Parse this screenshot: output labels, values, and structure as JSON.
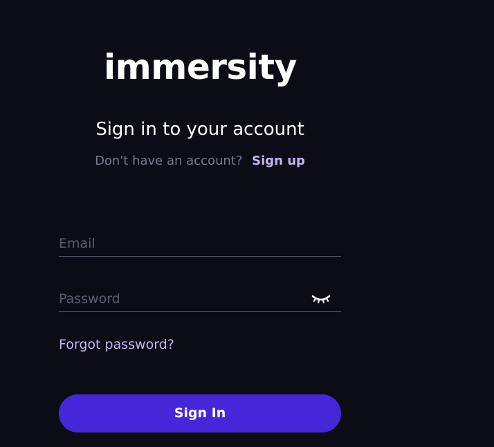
{
  "brand": {
    "name": "immersity"
  },
  "header": {
    "title": "Sign in to your account",
    "signup_prompt": "Don't have an account?",
    "signup_link": "Sign up"
  },
  "form": {
    "email": {
      "placeholder": "Email",
      "value": ""
    },
    "password": {
      "placeholder": "Password",
      "value": "",
      "toggle_icon": "eye-closed-icon"
    },
    "forgot_password": "Forgot password?",
    "submit_label": "Sign In"
  },
  "colors": {
    "background": "#0c0c17",
    "accent": "#4527d9",
    "link": "#c7b3f2",
    "muted_text": "#7a7a8c"
  }
}
